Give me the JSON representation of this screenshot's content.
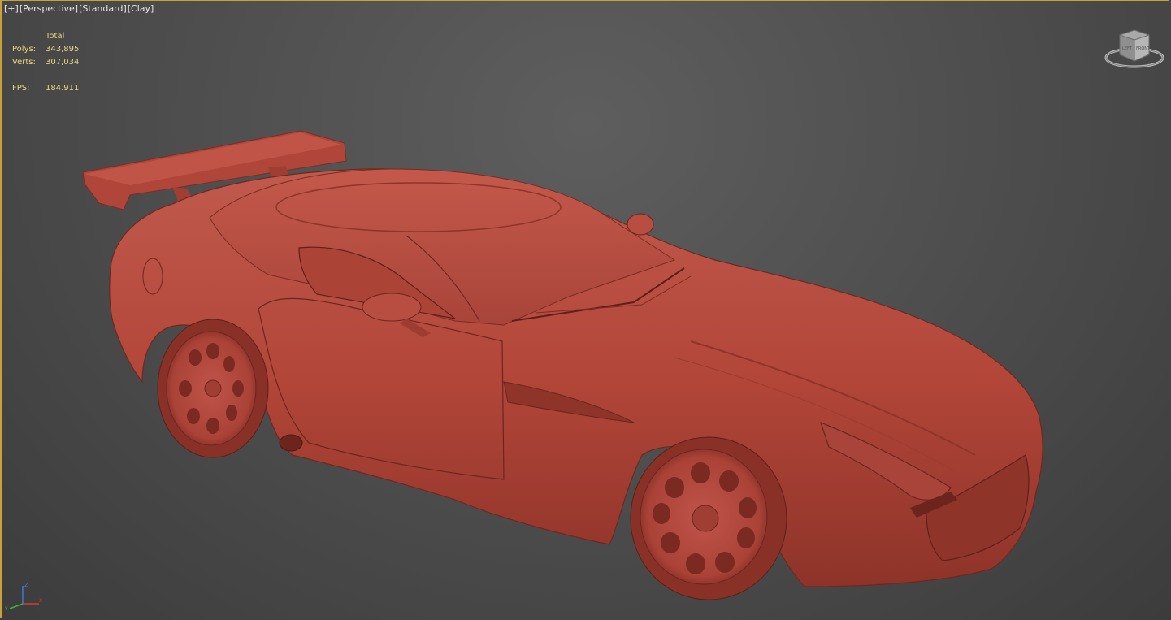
{
  "viewport": {
    "labels": [
      "[+]",
      "[Perspective]",
      "[Standard]",
      "[Clay]"
    ]
  },
  "stats": {
    "header": "Total",
    "polys_label": "Polys:",
    "polys_value": "343,895",
    "verts_label": "Verts:",
    "verts_value": "307,034",
    "fps_label": "FPS:",
    "fps_value": "184.911"
  },
  "viewcube": {
    "face_left": "LEFT",
    "face_front": "FRONT"
  },
  "axis_gizmo": {
    "z": "Z",
    "x": "X",
    "y": "Y"
  },
  "colors": {
    "clay": "#b5473b",
    "viewport_bg": "#4f4f4f",
    "stats_text": "#e9d77f",
    "active_border": "#c9a13a"
  }
}
